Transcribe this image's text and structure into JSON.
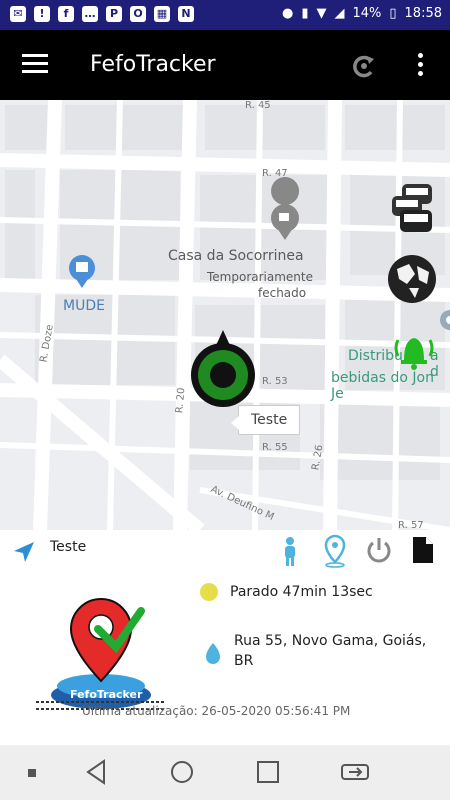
{
  "status_bar": {
    "battery": "14%",
    "time": "18:58"
  },
  "app_bar": {
    "title": "FefoTracker"
  },
  "map": {
    "places": [
      {
        "name": "Casa da Socorrinea",
        "sub": "Temporariamente",
        "sub2": "fechado"
      },
      {
        "name": "MUDE"
      },
      {
        "name": "Distribu",
        "name2": "a d",
        "line2": "bebidas do Jon Je"
      }
    ],
    "streets": [
      "R. 45",
      "R. 47",
      "R. Doze",
      "R. 20",
      "R. 53",
      "R. 55",
      "R. 26",
      "Av. Deufino M",
      "R. 57"
    ],
    "marker_label": "Teste"
  },
  "toolbar": {
    "device_name": "Teste"
  },
  "info": {
    "state": "Parado 47min 13sec",
    "address": "Rua 55, Novo Gama, Goiás, BR",
    "last_update": "Última atualização: 26-05-2020 05:56:41 PM",
    "logo_text": "FefoTracker"
  },
  "colors": {
    "status_bar": "#1f1f7a",
    "app_bar": "#000000",
    "marker": "#1f8a1f",
    "bell": "#22bb22",
    "pin": "#4fb3e0",
    "dot": "#e5de4a"
  }
}
